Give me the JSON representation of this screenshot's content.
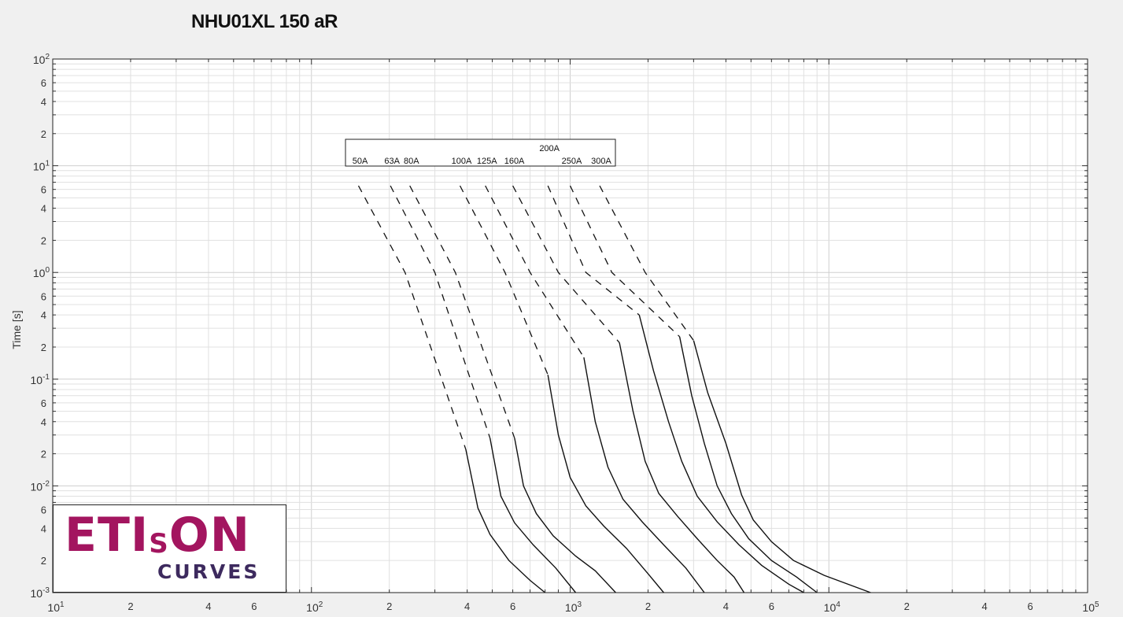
{
  "chart_data": {
    "type": "line",
    "title": "NHU01XL 150 aR",
    "xlabel": "",
    "ylabel": "Time [s]",
    "x_scale": "log",
    "y_scale": "log",
    "xlim": [
      10,
      100000
    ],
    "ylim": [
      0.001,
      100
    ],
    "grid": true,
    "legend_placement": "top-center",
    "x_major_ticks": [
      {
        "value": 10,
        "base": "10",
        "exp": "1"
      },
      {
        "value": 100,
        "base": "10",
        "exp": "2"
      },
      {
        "value": 1000,
        "base": "10",
        "exp": "3"
      },
      {
        "value": 10000,
        "base": "10",
        "exp": "4"
      },
      {
        "value": 100000,
        "base": "10",
        "exp": "5"
      }
    ],
    "y_major_ticks": [
      {
        "value": 100,
        "base": "10",
        "exp": "2"
      },
      {
        "value": 10,
        "base": "10",
        "exp": "1"
      },
      {
        "value": 1,
        "base": "10",
        "exp": "0"
      },
      {
        "value": 0.1,
        "base": "10",
        "exp": "-1"
      },
      {
        "value": 0.01,
        "base": "10",
        "exp": "-2"
      },
      {
        "value": 0.001,
        "base": "10",
        "exp": "-3"
      }
    ],
    "minor_tick_labels": [
      "2",
      "4",
      "6"
    ],
    "series": [
      {
        "name": "50A",
        "dashed": [
          [
            152,
            6.5
          ],
          [
            230,
            1.0
          ],
          [
            395,
            0.022
          ]
        ],
        "solid": [
          [
            395,
            0.022
          ],
          [
            440,
            0.0062
          ],
          [
            490,
            0.0035
          ],
          [
            580,
            0.002
          ],
          [
            700,
            0.0013
          ],
          [
            800,
            0.001
          ]
        ]
      },
      {
        "name": "63A",
        "dashed": [
          [
            202,
            6.5
          ],
          [
            300,
            1.0
          ],
          [
            490,
            0.028
          ]
        ],
        "solid": [
          [
            490,
            0.028
          ],
          [
            540,
            0.008
          ],
          [
            610,
            0.0045
          ],
          [
            720,
            0.0028
          ],
          [
            880,
            0.0017
          ],
          [
            1050,
            0.001
          ]
        ]
      },
      {
        "name": "80A",
        "dashed": [
          [
            240,
            6.5
          ],
          [
            360,
            1.0
          ],
          [
            610,
            0.028
          ]
        ],
        "solid": [
          [
            610,
            0.028
          ],
          [
            660,
            0.01
          ],
          [
            740,
            0.0055
          ],
          [
            860,
            0.0034
          ],
          [
            1050,
            0.0022
          ],
          [
            1250,
            0.0016
          ],
          [
            1500,
            0.001
          ]
        ]
      },
      {
        "name": "100A",
        "dashed": [
          [
            375,
            6.5
          ],
          [
            560,
            1.0
          ],
          [
            820,
            0.11
          ]
        ],
        "solid": [
          [
            820,
            0.11
          ],
          [
            900,
            0.03
          ],
          [
            1000,
            0.012
          ],
          [
            1150,
            0.0065
          ],
          [
            1350,
            0.0042
          ],
          [
            1650,
            0.0026
          ],
          [
            2000,
            0.0015
          ],
          [
            2300,
            0.001
          ]
        ]
      },
      {
        "name": "125A",
        "dashed": [
          [
            470,
            6.5
          ],
          [
            700,
            1.0
          ],
          [
            1130,
            0.16
          ]
        ],
        "solid": [
          [
            1130,
            0.16
          ],
          [
            1250,
            0.04
          ],
          [
            1400,
            0.015
          ],
          [
            1600,
            0.0075
          ],
          [
            1900,
            0.0046
          ],
          [
            2300,
            0.0028
          ],
          [
            2800,
            0.0017
          ],
          [
            3300,
            0.001
          ]
        ]
      },
      {
        "name": "160A",
        "dashed": [
          [
            600,
            6.5
          ],
          [
            900,
            1.0
          ],
          [
            1550,
            0.22
          ]
        ],
        "solid": [
          [
            1550,
            0.22
          ],
          [
            1750,
            0.05
          ],
          [
            1950,
            0.017
          ],
          [
            2200,
            0.0085
          ],
          [
            2600,
            0.0052
          ],
          [
            3100,
            0.0032
          ],
          [
            3700,
            0.002
          ],
          [
            4300,
            0.0014
          ],
          [
            4700,
            0.001
          ]
        ]
      },
      {
        "name": "200A",
        "dashed": [
          [
            820,
            6.5
          ],
          [
            1150,
            1.0
          ],
          [
            1850,
            0.4
          ]
        ],
        "solid": [
          [
            1850,
            0.4
          ],
          [
            2100,
            0.12
          ],
          [
            2400,
            0.04
          ],
          [
            2700,
            0.017
          ],
          [
            3100,
            0.008
          ],
          [
            3700,
            0.0046
          ],
          [
            4500,
            0.0028
          ],
          [
            5500,
            0.0018
          ],
          [
            7000,
            0.0012
          ],
          [
            8000,
            0.001
          ]
        ]
      },
      {
        "name": "250A",
        "dashed": [
          [
            1000,
            6.5
          ],
          [
            1450,
            1.0
          ],
          [
            2650,
            0.25
          ]
        ],
        "solid": [
          [
            2650,
            0.25
          ],
          [
            2950,
            0.07
          ],
          [
            3300,
            0.025
          ],
          [
            3700,
            0.01
          ],
          [
            4200,
            0.0055
          ],
          [
            4900,
            0.0032
          ],
          [
            6000,
            0.002
          ],
          [
            7500,
            0.0014
          ],
          [
            9000,
            0.001
          ]
        ]
      },
      {
        "name": "300A",
        "dashed": [
          [
            1300,
            6.5
          ],
          [
            1950,
            1.0
          ],
          [
            3000,
            0.23
          ]
        ],
        "solid": [
          [
            3000,
            0.23
          ],
          [
            3400,
            0.075
          ],
          [
            4000,
            0.025
          ],
          [
            4600,
            0.0082
          ],
          [
            5100,
            0.0048
          ],
          [
            6000,
            0.003
          ],
          [
            7300,
            0.002
          ],
          [
            9600,
            0.00145
          ],
          [
            14500,
            0.001
          ]
        ]
      }
    ]
  },
  "logo": {
    "eti": "ETI",
    "s": "S",
    "on": "ON",
    "curves": "CURVES"
  }
}
